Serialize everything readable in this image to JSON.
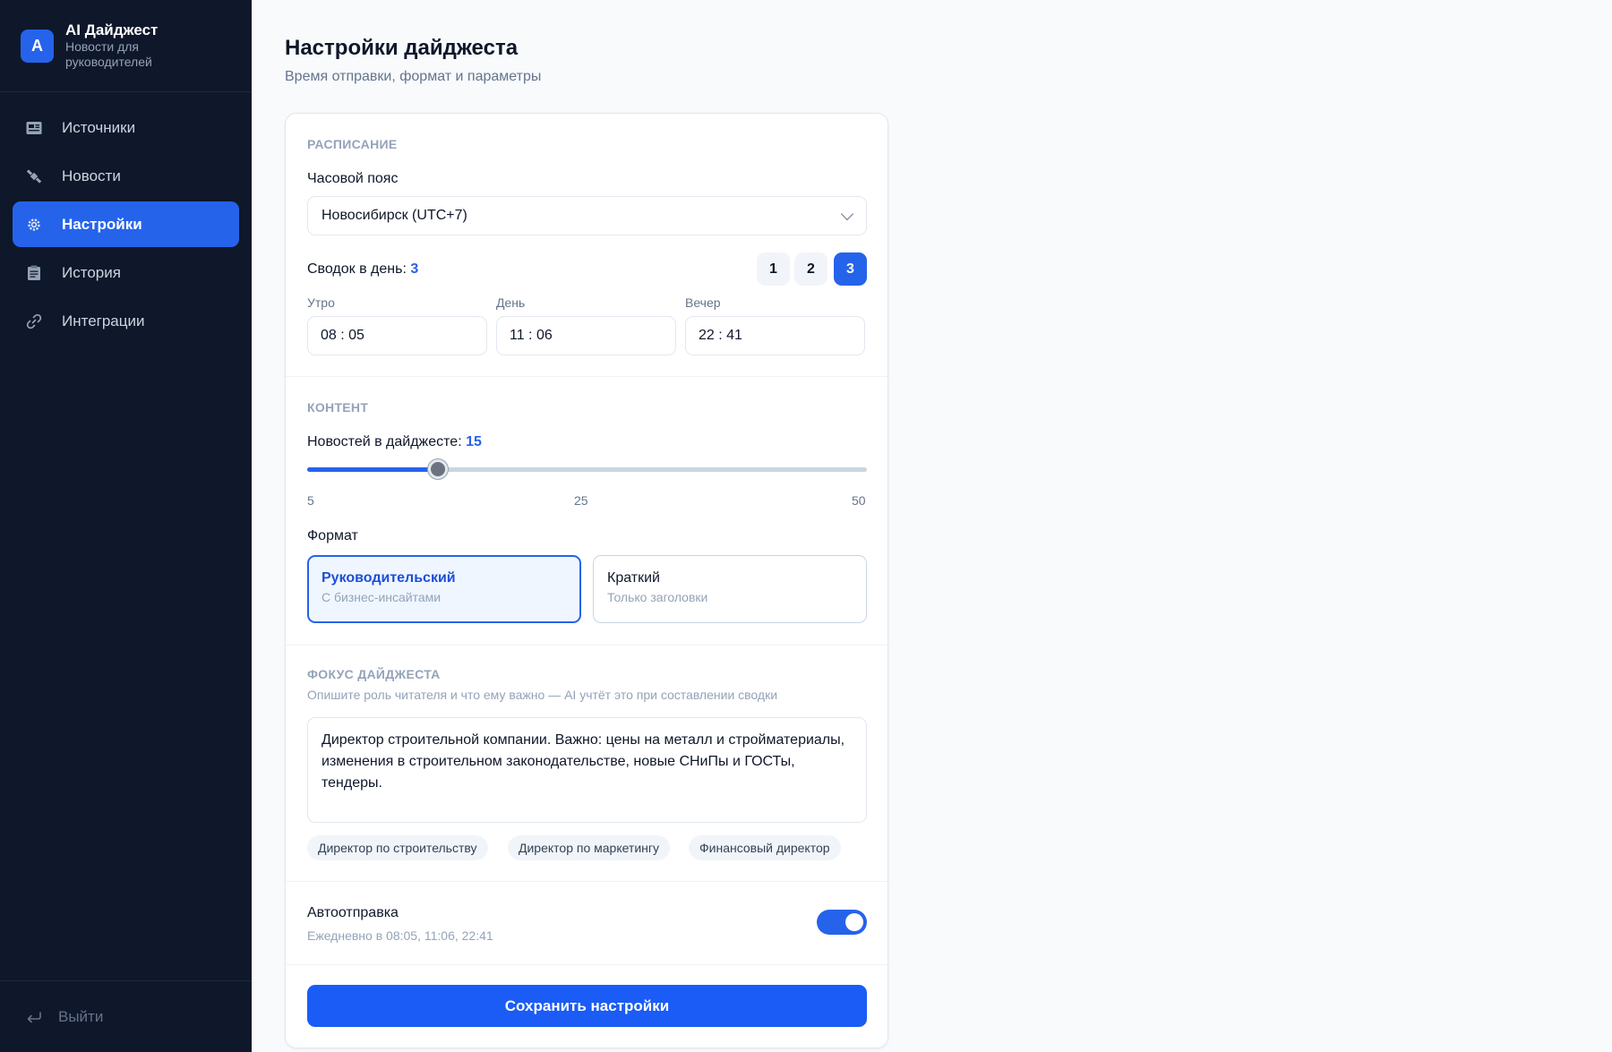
{
  "brand": {
    "logo_letter": "A",
    "title": "AI Дайджест",
    "subtitle": "Новости для руководителей"
  },
  "nav": {
    "items": [
      {
        "label": "Источники",
        "icon": "newspaper-icon",
        "active": false
      },
      {
        "label": "Новости",
        "icon": "satellite-icon",
        "active": false
      },
      {
        "label": "Настройки",
        "icon": "gear-icon",
        "active": true
      },
      {
        "label": "История",
        "icon": "clipboard-icon",
        "active": false
      },
      {
        "label": "Интеграции",
        "icon": "link-icon",
        "active": false
      }
    ],
    "logout_label": "Выйти"
  },
  "page": {
    "title": "Настройки дайджеста",
    "subtitle": "Время отправки, формат и параметры"
  },
  "schedule": {
    "section_label": "РАСПИСАНИЕ",
    "timezone_label": "Часовой пояс",
    "timezone_value": "Новосибирск (UTC+7)",
    "per_day_label": "Сводок в день:",
    "per_day_value": "3",
    "count_options": [
      "1",
      "2",
      "3"
    ],
    "selected_count": "3",
    "times": [
      {
        "label": "Утро",
        "value": "08 : 05"
      },
      {
        "label": "День",
        "value": "11 : 06"
      },
      {
        "label": "Вечер",
        "value": "22 : 41"
      }
    ]
  },
  "content": {
    "section_label": "КОНТЕНТ",
    "news_label": "Новостей в дайджесте:",
    "news_value": "15",
    "slider": {
      "min": 5,
      "max": 50,
      "value": 15,
      "ticks": [
        "5",
        "25",
        "50"
      ]
    },
    "format_label": "Формат",
    "formats": [
      {
        "title": "Руководительский",
        "desc": "С бизнес-инсайтами",
        "selected": true
      },
      {
        "title": "Краткий",
        "desc": "Только заголовки",
        "selected": false
      }
    ]
  },
  "focus": {
    "section_label": "ФОКУС ДАЙДЖЕСТА",
    "hint": "Опишите роль читателя и что ему важно — AI учтёт это при составлении сводки",
    "text": "Директор строительной компании. Важно: цены на металл и стройматериалы, изменения в строительном законодательстве, новые СНиПы и ГОСТы, тендеры.",
    "chips": [
      "Директор по строительству",
      "Директор по маркетингу",
      "Финансовый директор"
    ]
  },
  "auto": {
    "title": "Автоотправка",
    "subtitle": "Ежедневно в 08:05, 11:06, 22:41",
    "enabled": true
  },
  "save_label": "Сохранить настройки",
  "colors": {
    "sidebar_bg": "#0f172a",
    "accent": "#2563eb",
    "page_bg": "#f8fafc"
  }
}
